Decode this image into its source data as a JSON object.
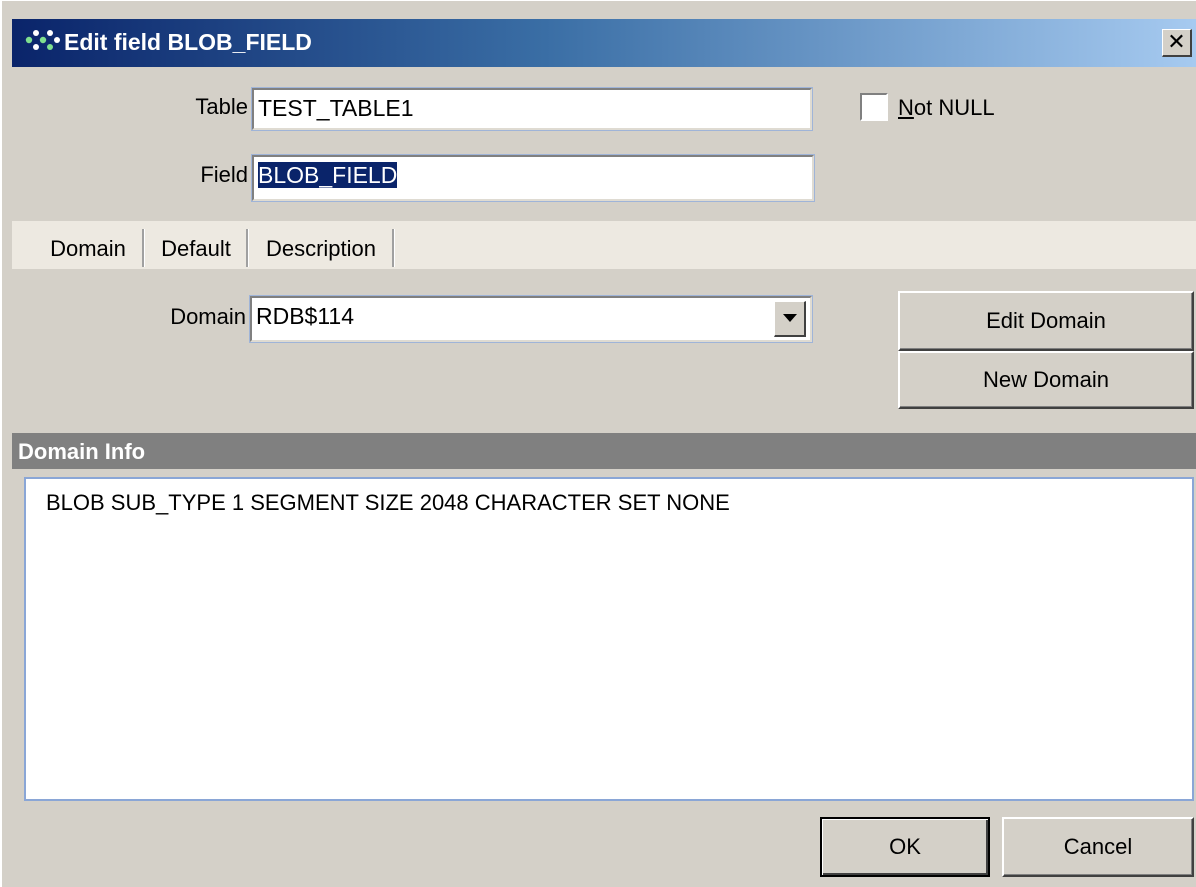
{
  "window": {
    "title": "Edit field BLOB_FIELD",
    "close_glyph": "✕"
  },
  "fields": {
    "table_label": "Table",
    "table_value": "TEST_TABLE1",
    "field_label": "Field",
    "field_value": "BLOB_FIELD",
    "not_null_label": "Not NULL",
    "not_null_checked": false
  },
  "tabs": [
    {
      "label": "Domain",
      "active": true
    },
    {
      "label": "Default",
      "active": false
    },
    {
      "label": "Description",
      "active": false
    }
  ],
  "domain": {
    "label": "Domain",
    "selected": "RDB$114",
    "edit_button": "Edit Domain",
    "new_button": "New Domain"
  },
  "domain_info": {
    "header": "Domain Info",
    "text": "BLOB SUB_TYPE 1 SEGMENT SIZE 2048 CHARACTER SET NONE"
  },
  "footer": {
    "ok_label": "OK",
    "cancel_label": "Cancel"
  },
  "icons": {
    "app": "app-dots-icon",
    "close": "close-icon",
    "dropdown": "chevron-down-icon"
  },
  "colors": {
    "title_gradient_start": "#0a246a",
    "title_gradient_end": "#a6caf0",
    "face": "#d4d0c8",
    "header_gray": "#808080"
  }
}
